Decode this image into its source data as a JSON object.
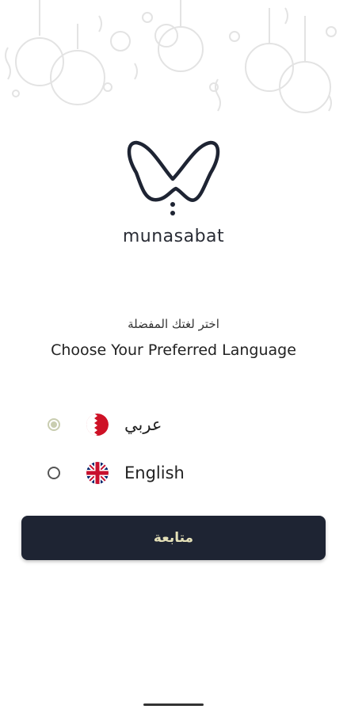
{
  "brand": {
    "name": "munasabat"
  },
  "prompt": {
    "arabic": "اختر لغتك المفضلة",
    "english": "Choose Your Preferred Language"
  },
  "languages": [
    {
      "label": "عربي",
      "flag": "bahrain-flag-icon",
      "selected": true
    },
    {
      "label": "English",
      "flag": "uk-flag-icon",
      "selected": false
    }
  ],
  "continue_button": {
    "label": "متابعة"
  },
  "colors": {
    "button_bg": "#1e2433",
    "button_text": "#e4e0b8",
    "radio_selected": "#c9cdb0",
    "logo_stroke": "#1e2433"
  }
}
